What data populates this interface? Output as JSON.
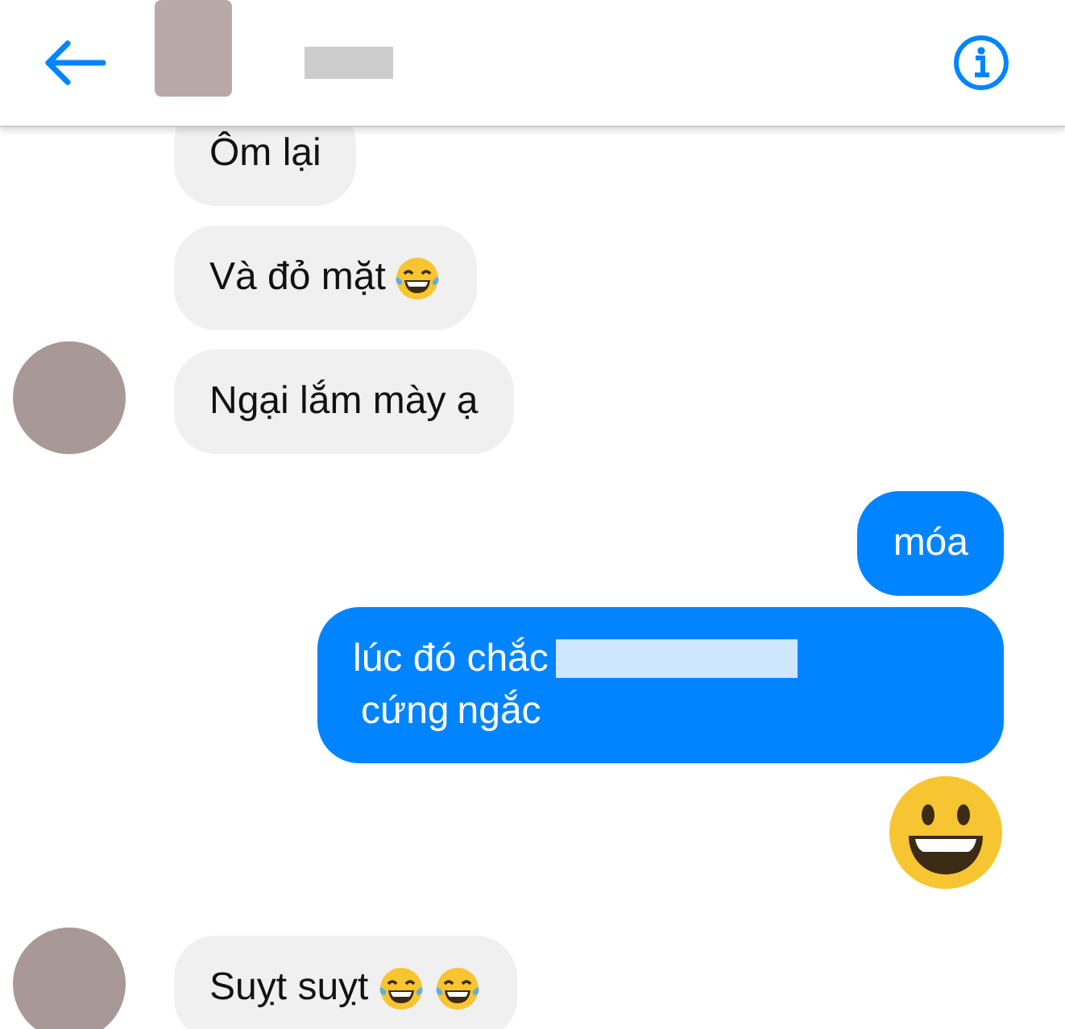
{
  "messages": [
    {
      "sent": false,
      "parts": [
        {
          "kind": "text",
          "text": "Ôm lại"
        }
      ]
    },
    {
      "sent": false,
      "parts": [
        {
          "kind": "text",
          "text": "Và đỏ mặt"
        },
        {
          "kind": "emoji"
        }
      ]
    },
    {
      "sent": false,
      "avatar": true,
      "parts": [
        {
          "kind": "text",
          "text": "Ngại lắm mày ạ"
        }
      ]
    },
    {
      "sent": true,
      "parts": [
        {
          "kind": "text",
          "text": "móa"
        }
      ]
    },
    {
      "sent": true,
      "parts": [
        {
          "kind": "text",
          "text": "lúc đó chắc"
        },
        {
          "kind": "redacted"
        },
        {
          "kind": "text",
          "text": "cứng"
        },
        {
          "kind": "text",
          "text": "ngắc"
        }
      ]
    },
    {
      "sent": true,
      "parts": [
        {
          "kind": "big_emoji"
        }
      ]
    },
    {
      "sent": false,
      "avatar": true,
      "parts": [
        {
          "kind": "text",
          "text": "Suỵt suỵt"
        },
        {
          "kind": "emoji"
        },
        {
          "kind": "emoji"
        }
      ]
    }
  ]
}
